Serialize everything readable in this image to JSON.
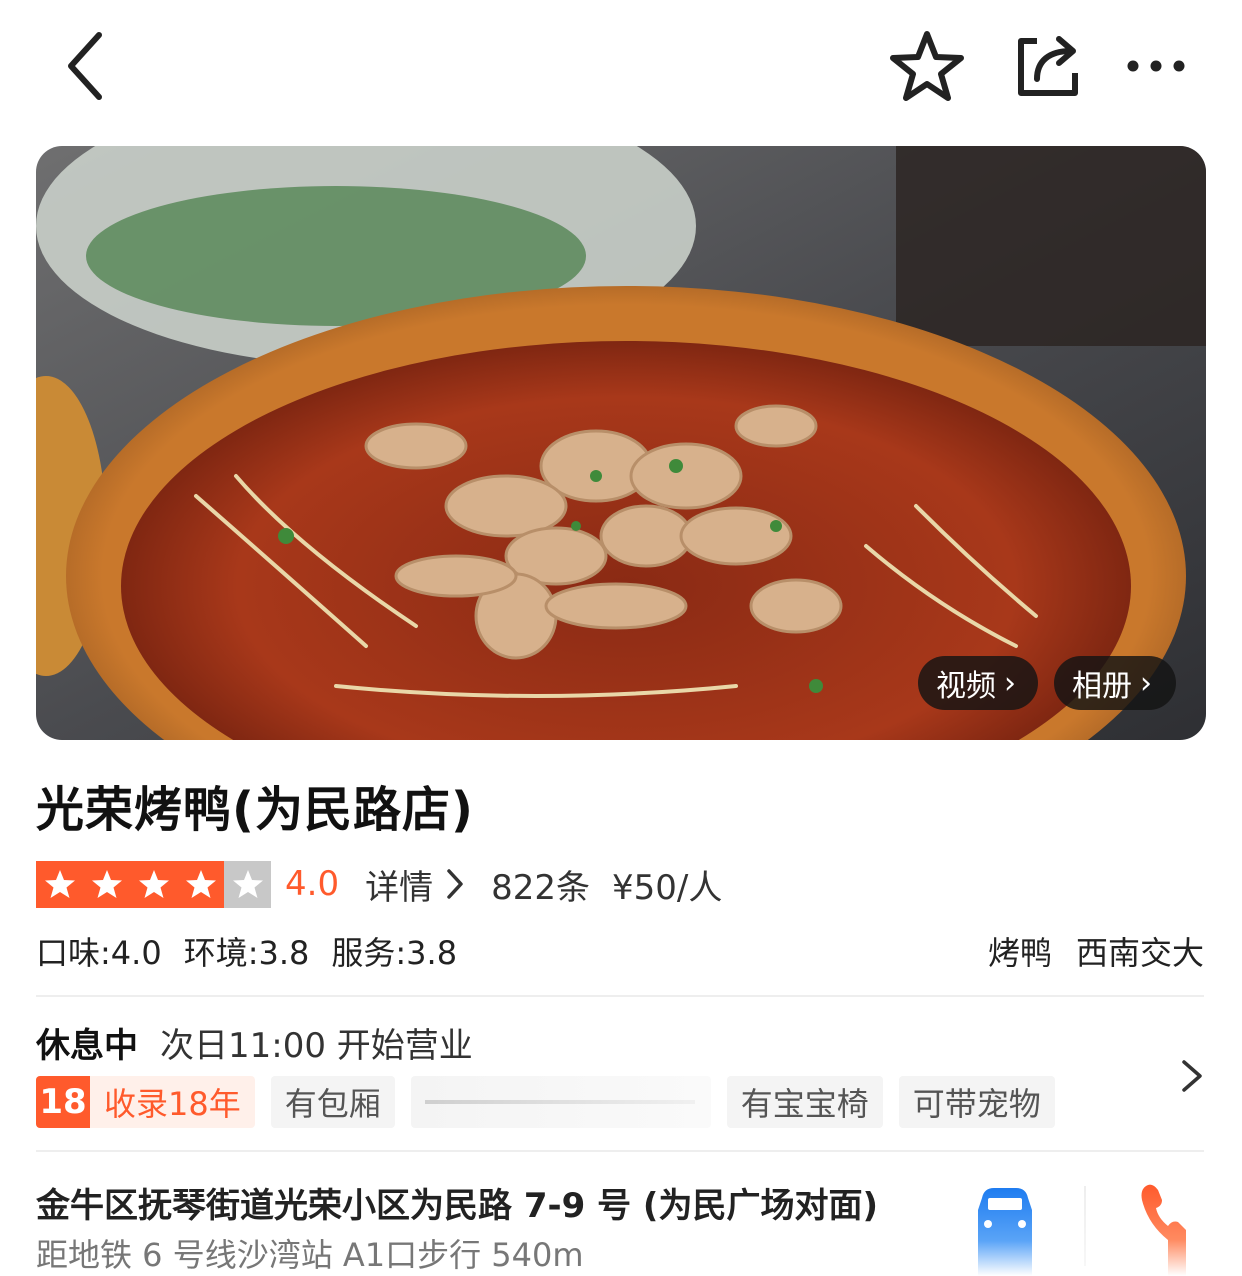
{
  "nav": {
    "back_icon": "chevron-left-icon",
    "favorite_icon": "star-outline-icon",
    "share_icon": "share-icon",
    "more_icon": "more-dots-icon"
  },
  "hero": {
    "video_label": "视频",
    "album_label": "相册"
  },
  "shop": {
    "title": "光荣烤鸭(为民路店)",
    "rating": {
      "stars_filled": 4,
      "stars_total": 5,
      "score": "4.0",
      "detail_label": "详情",
      "review_count": "822条",
      "price": "¥50/人",
      "star_color": "#ff5a2c"
    },
    "subscores": [
      "口味:4.0",
      "环境:3.8",
      "服务:3.8"
    ],
    "category_tags": [
      "烤鸭",
      "西南交大"
    ],
    "hours": {
      "status": "休息中",
      "next_open": "次日11:00 开始营业"
    },
    "features": {
      "years_number": "18",
      "years_label": "收录18年",
      "tags": [
        "有包厢",
        "有宝宝椅",
        "可带宠物"
      ]
    },
    "address": "金牛区抚琴街道光荣小区为民路 7-9 号 (为民广场对面)",
    "metro": "距地铁 6 号线沙湾站 A1口步行 540m",
    "navigate_icon": "car-icon",
    "phone_icon": "phone-icon"
  }
}
